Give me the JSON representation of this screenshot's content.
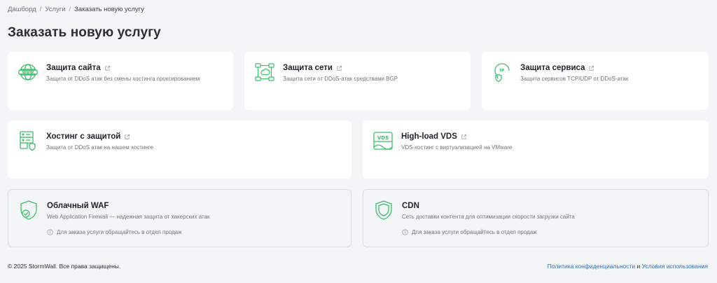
{
  "breadcrumb": {
    "items": [
      "Дашборд",
      "Услуги"
    ],
    "separator": "/",
    "current": "Заказать новую услугу"
  },
  "page": {
    "title": "Заказать новую услугу"
  },
  "accent_color": "#3cbf6a",
  "cards": [
    {
      "title": "Защита сайта",
      "desc": "Защита от DDoS атак без смены хостинга проксированием",
      "icon": "www-globe-icon"
    },
    {
      "title": "Защита сети",
      "desc": "Защита сети от DDoS-атак средствами BGP",
      "icon": "network-icon"
    },
    {
      "title": "Защита сервиса",
      "desc": "Защита сервисов TCP/UDP от DDoS-атак",
      "icon": "ip-shield-icon"
    },
    {
      "title": "Хостинг с защитой",
      "desc": "Защита от DDoS атак на нашем хостинге",
      "icon": "server-icon"
    },
    {
      "title": "High-load VDS",
      "desc": "VDS-хостинг с виртуализацией на VMware",
      "icon": "vds-icon"
    },
    {
      "title": "Облачный WAF",
      "desc": "Web Application Firewall — надежная защита от хакерских атак",
      "icon": "shield-check-icon",
      "note": "Для заказа услуги обращайтесь в отдел продаж"
    },
    {
      "title": "CDN",
      "desc": "Сеть доставки контента для оптимизации скорости загрузки сайта",
      "icon": "shield-icon",
      "note": "Для заказа услуги обращайтесь в отдел продаж"
    }
  ],
  "footer": {
    "copyright": "© 2025 StormWall. Все права защищены.",
    "privacy": "Политика конфиденциальности",
    "and": "и",
    "terms": "Условия использования"
  }
}
